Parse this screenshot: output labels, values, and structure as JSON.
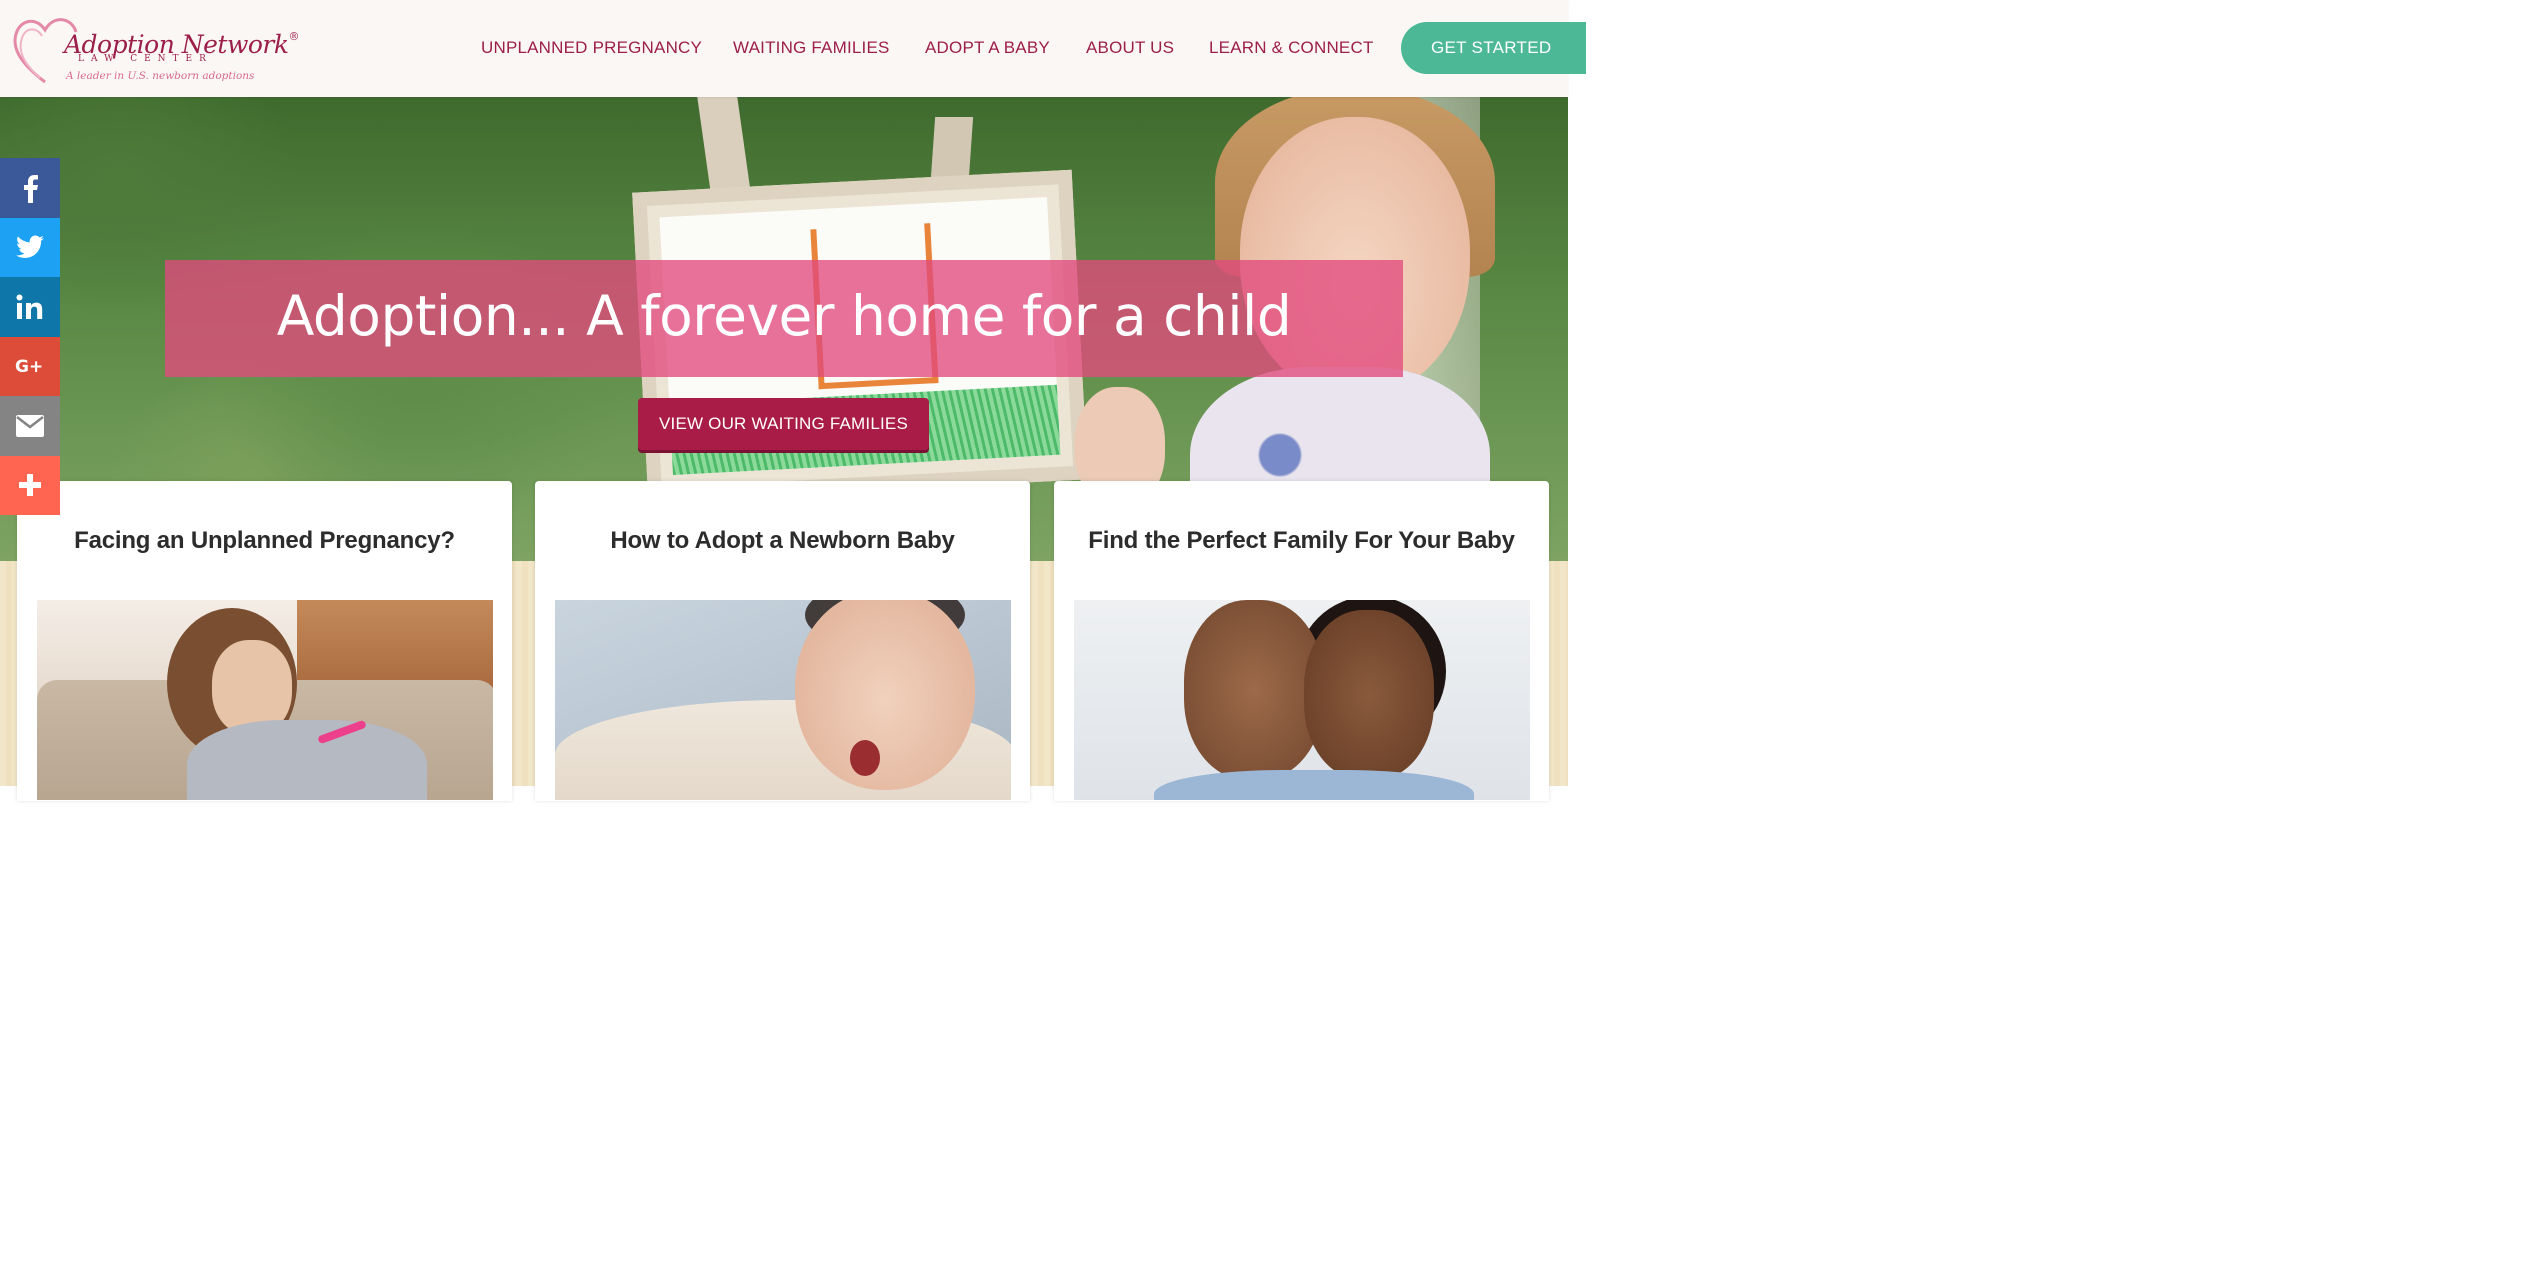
{
  "logo": {
    "name": "Adoption Network",
    "registered": "®",
    "sub": "LAW CENTER",
    "tagline": "A leader in U.S. newborn adoptions"
  },
  "nav": {
    "items": [
      "UNPLANNED PREGNANCY",
      "WAITING FAMILIES",
      "ADOPT A BABY",
      "ABOUT US",
      "LEARN & CONNECT"
    ],
    "cta": "GET STARTED"
  },
  "hero": {
    "headline": "Adoption... A forever home for a child",
    "button": "VIEW OUR WAITING FAMILIES"
  },
  "social": {
    "items": [
      {
        "icon": "facebook-icon",
        "color": "#3b5998"
      },
      {
        "icon": "twitter-icon",
        "color": "#1da1f2"
      },
      {
        "icon": "linkedin-icon",
        "color": "#0e76a8"
      },
      {
        "icon": "google-plus-icon",
        "color": "#dd4b39"
      },
      {
        "icon": "email-icon",
        "color": "#848484"
      },
      {
        "icon": "share-plus-icon",
        "color": "#ff6550"
      }
    ]
  },
  "cards": [
    {
      "title": "Facing an Unplanned Pregnancy?"
    },
    {
      "title": "How to Adopt a Newborn Baby"
    },
    {
      "title": "Find the Perfect Family For Your Baby"
    }
  ],
  "colors": {
    "brand": "#9c1f4b",
    "accent_green": "#4db896",
    "hero_band": "#e24a7d",
    "hero_button": "#a81c47"
  }
}
